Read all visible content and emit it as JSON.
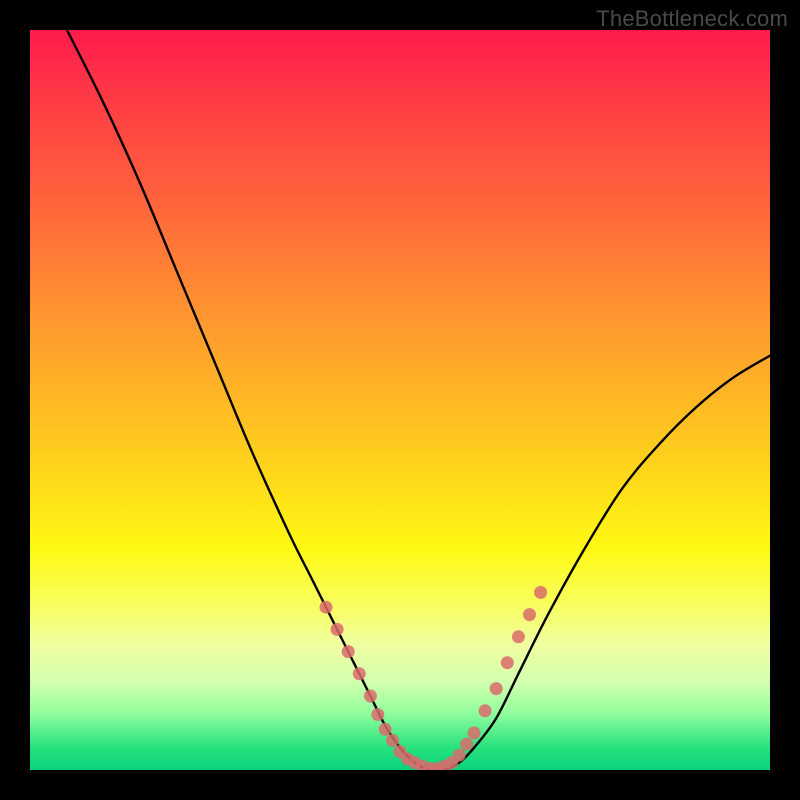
{
  "watermark": "TheBottleneck.com",
  "chart_data": {
    "type": "line",
    "title": "",
    "xlabel": "",
    "ylabel": "",
    "xlim": [
      0,
      100
    ],
    "ylim": [
      0,
      100
    ],
    "series": [
      {
        "name": "curve",
        "x": [
          5,
          10,
          15,
          20,
          25,
          30,
          35,
          38,
          40,
          42,
          44,
          46,
          48,
          50,
          52,
          54,
          56,
          58,
          60,
          63,
          66,
          70,
          75,
          80,
          85,
          90,
          95,
          100
        ],
        "y": [
          100,
          90,
          79,
          67,
          55,
          43,
          32,
          26,
          22,
          18,
          14,
          10,
          6,
          3,
          1,
          0,
          0,
          1,
          3,
          7,
          13,
          21,
          30,
          38,
          44,
          49,
          53,
          56
        ]
      }
    ],
    "markers": [
      {
        "x": 40.0,
        "y": 22.0
      },
      {
        "x": 41.5,
        "y": 19.0
      },
      {
        "x": 43.0,
        "y": 16.0
      },
      {
        "x": 44.5,
        "y": 13.0
      },
      {
        "x": 46.0,
        "y": 10.0
      },
      {
        "x": 47.0,
        "y": 7.5
      },
      {
        "x": 48.0,
        "y": 5.5
      },
      {
        "x": 49.0,
        "y": 4.0
      },
      {
        "x": 50.0,
        "y": 2.5
      },
      {
        "x": 51.0,
        "y": 1.5
      },
      {
        "x": 52.0,
        "y": 1.0
      },
      {
        "x": 53.0,
        "y": 0.5
      },
      {
        "x": 54.0,
        "y": 0.2
      },
      {
        "x": 55.0,
        "y": 0.2
      },
      {
        "x": 56.0,
        "y": 0.5
      },
      {
        "x": 57.0,
        "y": 1.0
      },
      {
        "x": 58.0,
        "y": 2.0
      },
      {
        "x": 59.0,
        "y": 3.5
      },
      {
        "x": 60.0,
        "y": 5.0
      },
      {
        "x": 61.5,
        "y": 8.0
      },
      {
        "x": 63.0,
        "y": 11.0
      },
      {
        "x": 64.5,
        "y": 14.5
      },
      {
        "x": 66.0,
        "y": 18.0
      },
      {
        "x": 67.5,
        "y": 21.0
      },
      {
        "x": 69.0,
        "y": 24.0
      }
    ],
    "marker_color": "#d96b6b",
    "curve_color": "#000000"
  }
}
